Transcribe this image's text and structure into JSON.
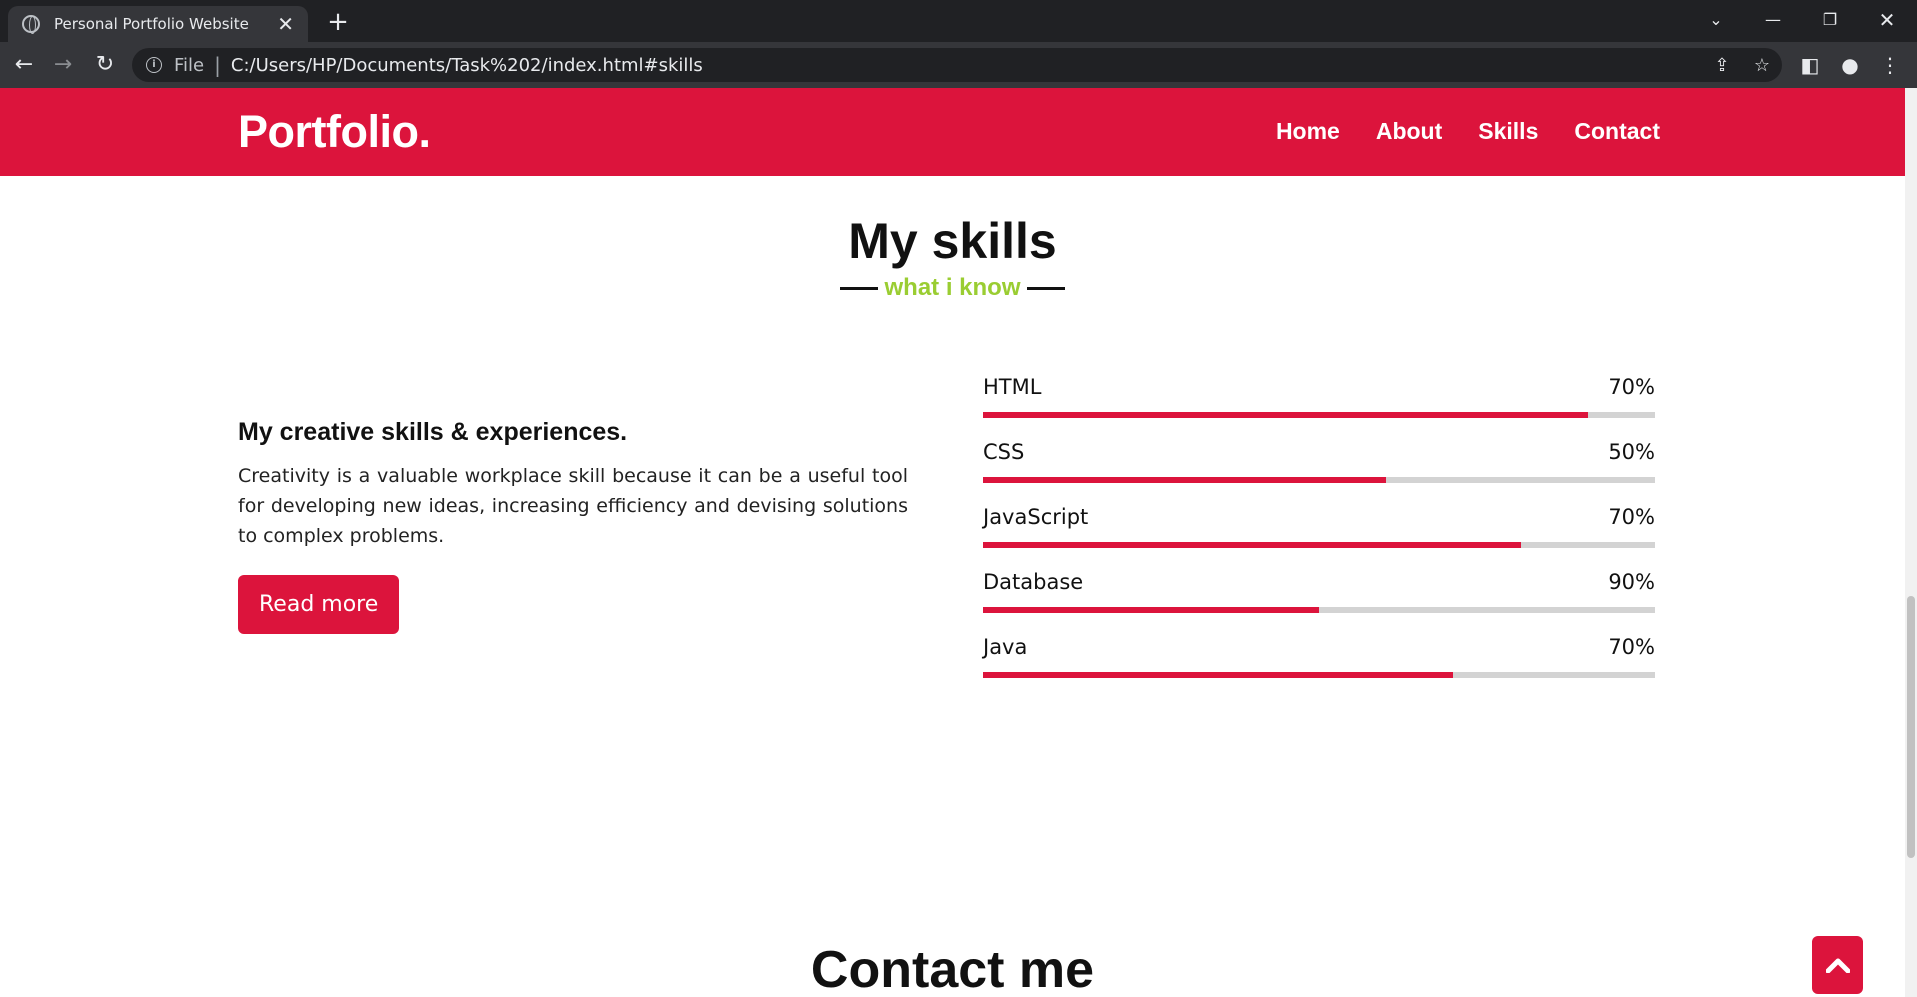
{
  "browser": {
    "tab_title": "Personal Portfolio Website",
    "new_tab_label": "+",
    "address_prefix": "File",
    "url": "C:/Users/HP/Documents/Task%202/index.html#skills"
  },
  "navbar": {
    "logo": "Portfolio.",
    "links": [
      "Home",
      "About",
      "Skills",
      "Contact"
    ]
  },
  "skills": {
    "title": "My skills",
    "subtitle": "what i know",
    "heading": "My creative skills & experiences.",
    "text": "Creativity is a valuable workplace skill because it can be a useful tool for developing new ideas, increasing efficiency and devising solutions to complex problems.",
    "button": "Read more",
    "items": [
      {
        "name": "HTML",
        "label": "70%",
        "fill": 0.9
      },
      {
        "name": "CSS",
        "label": "50%",
        "fill": 0.6
      },
      {
        "name": "JavaScript",
        "label": "70%",
        "fill": 0.8
      },
      {
        "name": "Database",
        "label": "90%",
        "fill": 0.5
      },
      {
        "name": "Java",
        "label": "70%",
        "fill": 0.7
      }
    ]
  },
  "contact": {
    "title": "Contact me"
  },
  "colors": {
    "accent": "#dc143c",
    "subtitle": "#9acd32",
    "track": "#d3d3d3"
  }
}
